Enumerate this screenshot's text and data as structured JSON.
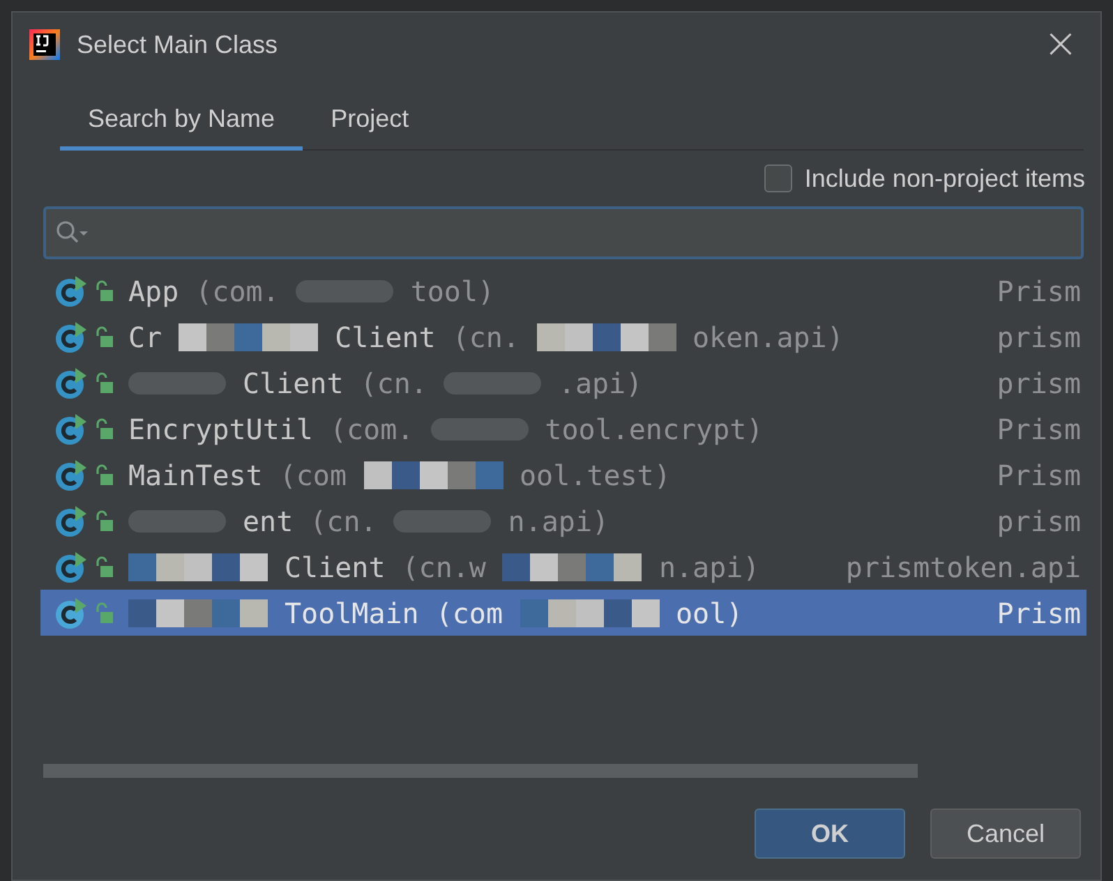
{
  "window": {
    "title": "Select Main Class",
    "close": "×"
  },
  "tabs": [
    {
      "label": "Search by Name",
      "selected": true
    },
    {
      "label": "Project",
      "selected": false
    }
  ],
  "include_non_project": {
    "label": "Include non-project items",
    "checked": false
  },
  "rows": [
    {
      "selected": false,
      "parts": [
        {
          "kind": "name",
          "text": "App"
        },
        {
          "kind": "pkg",
          "text": "(com."
        },
        {
          "kind": "blur"
        },
        {
          "kind": "pkg",
          "text": "tool)"
        }
      ],
      "module": "Prism"
    },
    {
      "selected": false,
      "parts": [
        {
          "kind": "name",
          "text": "Cr"
        },
        {
          "kind": "mosaic"
        },
        {
          "kind": "name",
          "text": "Client"
        },
        {
          "kind": "pkg",
          "text": "(cn."
        },
        {
          "kind": "mosaic"
        },
        {
          "kind": "pkg",
          "text": "oken.api)"
        }
      ],
      "module": "prism"
    },
    {
      "selected": false,
      "parts": [
        {
          "kind": "blur"
        },
        {
          "kind": "name",
          "text": "Client"
        },
        {
          "kind": "pkg",
          "text": "(cn."
        },
        {
          "kind": "blur"
        },
        {
          "kind": "pkg",
          "text": ".api)"
        }
      ],
      "module": "prism"
    },
    {
      "selected": false,
      "parts": [
        {
          "kind": "name",
          "text": "EncryptUtil"
        },
        {
          "kind": "pkg",
          "text": "(com."
        },
        {
          "kind": "blur"
        },
        {
          "kind": "pkg",
          "text": "tool.encrypt)"
        }
      ],
      "module": "Prism"
    },
    {
      "selected": false,
      "parts": [
        {
          "kind": "name",
          "text": "MainTest"
        },
        {
          "kind": "pkg",
          "text": "(com"
        },
        {
          "kind": "mosaic"
        },
        {
          "kind": "pkg",
          "text": "ool.test)"
        }
      ],
      "module": "Prism"
    },
    {
      "selected": false,
      "parts": [
        {
          "kind": "blur"
        },
        {
          "kind": "name",
          "text": "ent"
        },
        {
          "kind": "pkg",
          "text": "(cn."
        },
        {
          "kind": "blur"
        },
        {
          "kind": "pkg",
          "text": "n.api)"
        }
      ],
      "module": "prism"
    },
    {
      "selected": false,
      "parts": [
        {
          "kind": "mosaic"
        },
        {
          "kind": "name",
          "text": "Client"
        },
        {
          "kind": "pkg",
          "text": "(cn.w"
        },
        {
          "kind": "mosaic"
        },
        {
          "kind": "pkg",
          "text": "n.api)"
        }
      ],
      "module": "prismtoken.api"
    },
    {
      "selected": true,
      "parts": [
        {
          "kind": "mosaic"
        },
        {
          "kind": "name",
          "text": "ToolMain"
        },
        {
          "kind": "pkg",
          "text": "(com"
        },
        {
          "kind": "mosaic"
        },
        {
          "kind": "pkg",
          "text": "ool)"
        }
      ],
      "module": "Prism"
    }
  ],
  "buttons": [
    {
      "label": "OK",
      "kind": "primary"
    },
    {
      "label": "Cancel",
      "kind": "secondary"
    }
  ]
}
